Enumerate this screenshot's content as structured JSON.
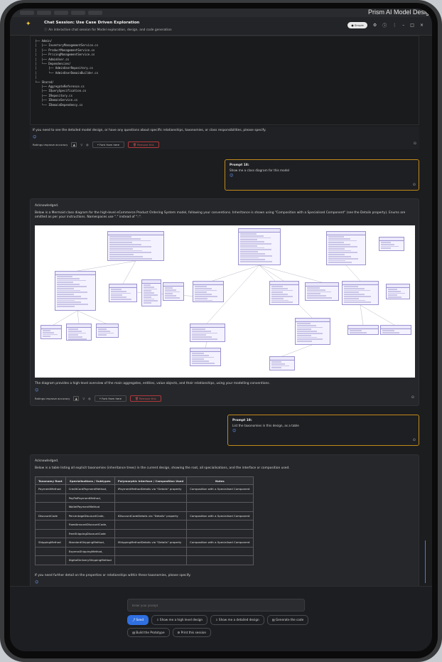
{
  "window": {
    "title": "Prism AI Model Desig"
  },
  "header": {
    "title": "Chat Session: Use Case Driven Exploration",
    "subtitle": "An interactive chat session for Model exploration, design, and code generation",
    "badge": "Simple",
    "icons": [
      "settings-icon",
      "info-icon",
      "more-icon",
      "minimize-icon",
      "maximize-icon",
      "close-icon"
    ]
  },
  "code_tree": [
    "├── Admin/",
    "│   ├── InventoryManagementService.cs",
    "│   ├── ProductManagementService.cs",
    "│   ├── PricingManagementService.cs",
    "│   ├── AdminUser.cs",
    "│   └── Dependencies/",
    "│       ├── AdminUserRepository.cs",
    "│       └── AdminUserDomainBuilder.cs",
    "│",
    "└── Shared/",
    "    ├── AggregateReference.cs",
    "    ├── IQuerySpecification.cs",
    "    ├── IRepository.cs",
    "    ├── IDomainService.cs",
    "    └── IDomainDependency.cs"
  ],
  "messages": {
    "first_followup": "If you need to see the detailed model design, or have any questions about specific relationships, taxonomies, or class responsibilities, please specify.",
    "prompt18_title": "Prompt 18:",
    "prompt18_text": "Show me a class diagram for this model",
    "ack1": "Acknowledged.",
    "diagram_intro": "Below is a Mermaid class diagram for the high-level eCommerce Product Ordering System model, following your conventions. Inheritance is shown using \"Composition with a Specialised Component\" (see the Details property). Enums are omitted as per your instructions. Namespaces use \".\" instead of \"::\".",
    "diagram_outro": "The diagram provides a high-level overview of the main aggregates, entities, value objects, and their relationships, using your modelling conventions.",
    "prompt19_title": "Prompt 19:",
    "prompt19_text": "List the taxonomies in this design, as a table",
    "ack2": "Acknowledged.",
    "table_intro": "Below is a table listing all explicit taxonomies (inheritance trees) in the current design, showing the root, all specialisations, and the interface or composition used.",
    "table_outro": "If you need further detail on the properties or relationships within these taxonomies, please specify.",
    "marker": "☺"
  },
  "ratings": {
    "label": "Ratings improve accuracy",
    "fork": "Fork from here",
    "remove": "Remove this"
  },
  "taxonomy_table": {
    "headers": [
      "Taxonomy Root",
      "Specialisations / Subtypes",
      "Polymorphic Interface / Composition Used",
      "Notes"
    ],
    "rows": [
      [
        "PaymentMethod",
        "CreditCardPaymentMethod,",
        "IPaymentMethodDetails via \"Details\" property",
        "Composition with a Specialised Component"
      ],
      [
        "",
        "PayPalPaymentMethod,",
        "",
        ""
      ],
      [
        "",
        "WalletPaymentMethod",
        "",
        ""
      ],
      [
        "DiscountCode",
        "PercentageDiscountCode,",
        "IDiscountCodeDetails via \"Details\" property",
        "Composition with a Specialised Component"
      ],
      [
        "",
        "FixedAmountDiscountCode,",
        "",
        ""
      ],
      [
        "",
        "FreeShippingDiscountCode",
        "",
        ""
      ],
      [
        "ShippingMethod",
        "StandardShippingMethod,",
        "IShippingMethodDetails via \"Details\" property",
        "Composition with a Specialised Component"
      ],
      [
        "",
        "ExpressShippingMethod,",
        "",
        ""
      ],
      [
        "",
        "DigitalDeliveryShippingMethod",
        "",
        ""
      ]
    ]
  },
  "input": {
    "placeholder": "Enter your prompt",
    "send": "Send",
    "actions": [
      "Show me a high level design",
      "Show me a detailed design",
      "Generate the code",
      "Build the Prototype",
      "Print this session"
    ]
  }
}
